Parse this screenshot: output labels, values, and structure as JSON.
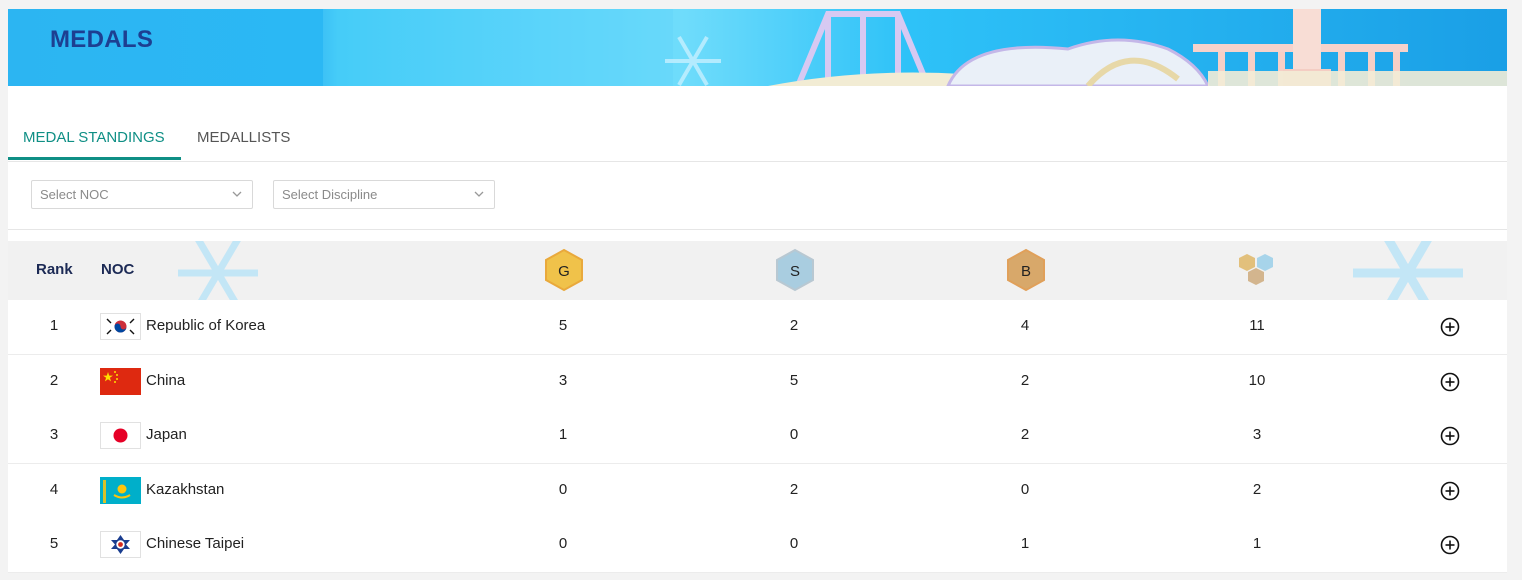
{
  "header": {
    "title": "MEDALS"
  },
  "tabs": [
    {
      "label": "MEDAL STANDINGS",
      "active": true
    },
    {
      "label": "MEDALLISTS",
      "active": false
    }
  ],
  "filters": {
    "noc_placeholder": "Select NOC",
    "discipline_placeholder": "Select Discipline"
  },
  "table": {
    "headers": {
      "rank": "Rank",
      "noc": "NOC",
      "gold": "G",
      "silver": "S",
      "bronze": "B"
    },
    "rows": [
      {
        "rank": "1",
        "noc": "Republic of Korea",
        "flag": "korea-flag",
        "gold": "5",
        "silver": "2",
        "bronze": "4",
        "total": "11"
      },
      {
        "rank": "2",
        "noc": "China",
        "flag": "china-flag",
        "gold": "3",
        "silver": "5",
        "bronze": "2",
        "total": "10"
      },
      {
        "rank": "3",
        "noc": "Japan",
        "flag": "japan-flag",
        "gold": "1",
        "silver": "0",
        "bronze": "2",
        "total": "3"
      },
      {
        "rank": "4",
        "noc": "Kazakhstan",
        "flag": "kazakhstan-flag",
        "gold": "0",
        "silver": "2",
        "bronze": "0",
        "total": "2"
      },
      {
        "rank": "5",
        "noc": "Chinese Taipei",
        "flag": "chinese-taipei-flag",
        "gold": "0",
        "silver": "0",
        "bronze": "1",
        "total": "1"
      }
    ]
  },
  "colors": {
    "accent": "#0f8f85",
    "title": "#1d3f91",
    "gold": "#f0c24a",
    "silver": "#a9cde0",
    "bronze": "#d8a86a"
  }
}
